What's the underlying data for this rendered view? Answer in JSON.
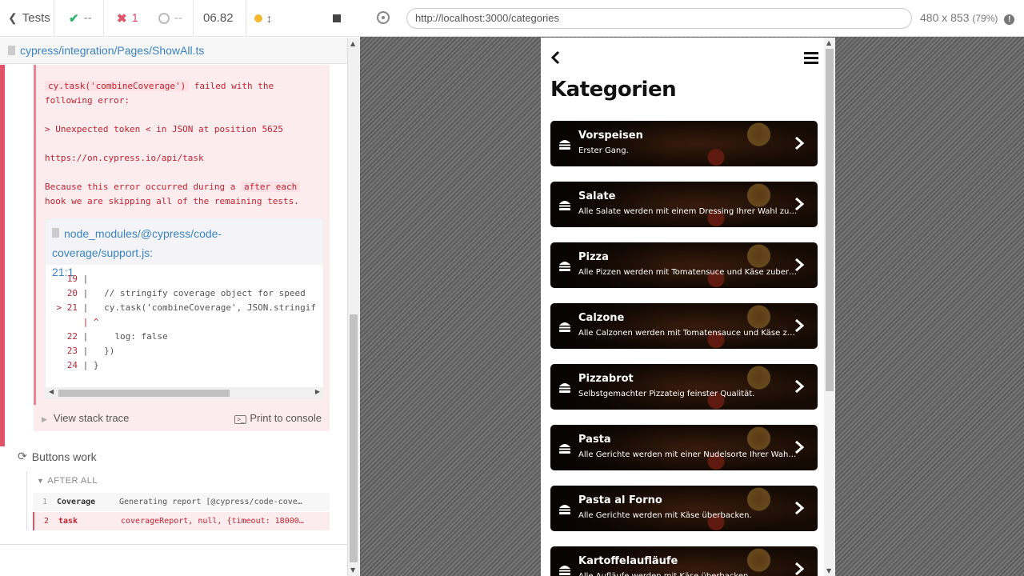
{
  "reporter": {
    "tests_label": "Tests",
    "passed": "--",
    "failed": "1",
    "pending": "--",
    "duration": "06.82",
    "spec_path": "cypress/integration/Pages/ShowAll.ts"
  },
  "error": {
    "cmd_code": "cy.task('combineCoverage')",
    "msg1": " failed with the",
    "msg2": "following error:",
    "detail": "> Unexpected token < in JSON at position 5625",
    "link": "https://on.cypress.io/api/task",
    "because": "Because this error occurred during a ",
    "hook_code": "after each",
    "skip": "hook we are skipping all of the remaining tests.",
    "file": "node_modules/@cypress/code-coverage/support.js:",
    "file_line": "21:1",
    "code_lines": [
      {
        "num": "19",
        "text": "|"
      },
      {
        "num": "20",
        "text": "|   // stringify coverage object for speed"
      },
      {
        "num": "> 21",
        "text": "|   cy.task('combineCoverage', JSON.stringif"
      },
      {
        "num": "",
        "text": "| ^"
      },
      {
        "num": "22",
        "text": "|     log: false"
      },
      {
        "num": "23",
        "text": "|   })"
      },
      {
        "num": "24",
        "text": "| }"
      }
    ],
    "view_stack": "View stack trace",
    "print_console": "Print to console"
  },
  "test_title": "Buttons work",
  "after_all": "AFTER ALL",
  "commands": [
    {
      "num": "1",
      "name": "Coverage",
      "msg": "Generating report [@cypress/code-cove…"
    },
    {
      "num": "2",
      "name": "task",
      "msg": "coverageReport, null, {timeout: 18000…"
    }
  ],
  "aut": {
    "url": "http://localhost:3000/categories",
    "viewport": "480 x 853",
    "scale": "(79%)"
  },
  "app": {
    "title": "Kategorien",
    "categories": [
      {
        "name": "Vorspeisen",
        "desc": "Erster Gang."
      },
      {
        "name": "Salate",
        "desc": "Alle Salate werden mit einem Dressing Ihrer Wahl zu…"
      },
      {
        "name": "Pizza",
        "desc": "Alle Pizzen werden mit Tomatensuce und Käse zuber…"
      },
      {
        "name": "Calzone",
        "desc": "Alle Calzonen werden mit Tomatensauce und Käse z…"
      },
      {
        "name": "Pizzabrot",
        "desc": "Selbstgemachter Pizzateig feinster Qualität."
      },
      {
        "name": "Pasta",
        "desc": "Alle Gerichte werden mit einer Nudelsorte Ihrer Wahl…"
      },
      {
        "name": "Pasta al Forno",
        "desc": "Alle Gerichte werden mit Käse überbacken."
      },
      {
        "name": "Kartoffelaufläufe",
        "desc": "Alle Aufläufe werden mit Käse überbacken."
      }
    ]
  }
}
